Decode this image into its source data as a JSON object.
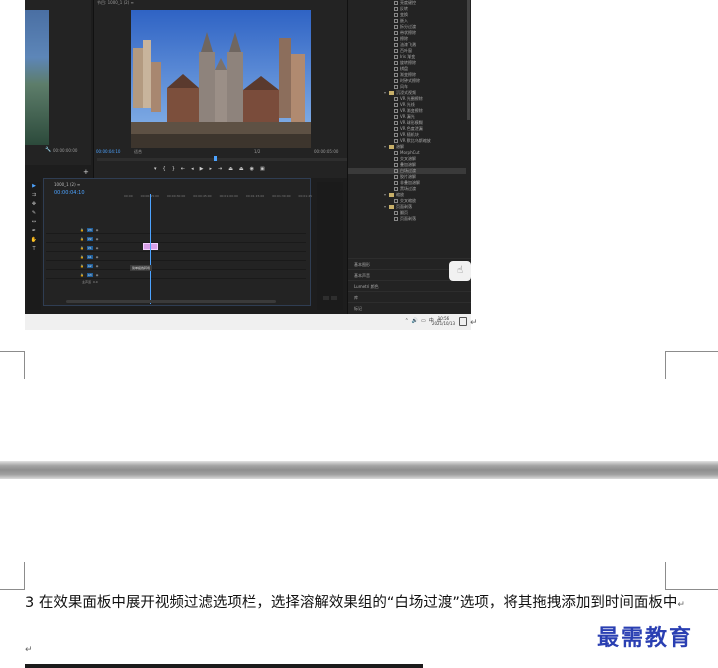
{
  "screenshot": {
    "source_monitor": {
      "timecode": "00:00:00:00"
    },
    "program_monitor": {
      "title": "节目: 1000_1 (2) ≡",
      "timecode_current": "00:00:04:10",
      "fit": "适合",
      "scale": "1/2",
      "timecode_total": "00:00:05:00"
    },
    "effects": {
      "items": [
        {
          "label": "亮度键控",
          "kind": "effect"
        },
        {
          "label": "反转",
          "kind": "effect"
        },
        {
          "label": "变换",
          "kind": "effect"
        },
        {
          "label": "嵌入",
          "kind": "effect"
        },
        {
          "label": "拆分过渡",
          "kind": "effect"
        },
        {
          "label": "带状擦除",
          "kind": "effect"
        },
        {
          "label": "擦除",
          "kind": "effect"
        },
        {
          "label": "油漆飞溅",
          "kind": "effect"
        },
        {
          "label": "百叶窗",
          "kind": "effect"
        },
        {
          "label": "Iris 渐变",
          "kind": "effect"
        },
        {
          "label": "旋转擦除",
          "kind": "effect"
        },
        {
          "label": "棋盘",
          "kind": "effect"
        },
        {
          "label": "渐变擦除",
          "kind": "effect"
        },
        {
          "label": "时钟式擦除",
          "kind": "effect"
        },
        {
          "label": "风车",
          "kind": "effect"
        },
        {
          "label": "沉浸式视频",
          "kind": "folder"
        },
        {
          "label": "VR 光圈擦除",
          "kind": "effect"
        },
        {
          "label": "VR 光线",
          "kind": "effect"
        },
        {
          "label": "VR 渐变擦除",
          "kind": "effect"
        },
        {
          "label": "VR 漏光",
          "kind": "effect"
        },
        {
          "label": "VR 球形模糊",
          "kind": "effect"
        },
        {
          "label": "VR 色度泄漏",
          "kind": "effect"
        },
        {
          "label": "VR 随机块",
          "kind": "effect"
        },
        {
          "label": "VR 默比乌斯缩放",
          "kind": "effect"
        },
        {
          "label": "溶解",
          "kind": "folder"
        },
        {
          "label": "MorphCut",
          "kind": "effect"
        },
        {
          "label": "交叉溶解",
          "kind": "effect"
        },
        {
          "label": "叠加溶解",
          "kind": "effect"
        },
        {
          "label": "白场过渡",
          "kind": "effect",
          "selected": true
        },
        {
          "label": "胶片溶解",
          "kind": "effect"
        },
        {
          "label": "非叠加溶解",
          "kind": "effect"
        },
        {
          "label": "黑场过渡",
          "kind": "effect"
        },
        {
          "label": "缩放",
          "kind": "folder"
        },
        {
          "label": "交叉缩放",
          "kind": "effect"
        },
        {
          "label": "页面剥落",
          "kind": "folder"
        },
        {
          "label": "翻页",
          "kind": "effect"
        },
        {
          "label": "页面剥落",
          "kind": "effect"
        }
      ],
      "footer": [
        "基本图形",
        "基本声音",
        "Lumetri 颜色",
        "库",
        "标记"
      ]
    },
    "timeline": {
      "tab": "1000_1 (2) ≡",
      "timecode": "00:00:04:10",
      "ruler": [
        "00:00",
        "00:00:15:00",
        "00:00:30:00",
        "00:00:45:00",
        "00:01:00:00",
        "00:01:15:00",
        "00:01:30:00",
        "00:01:45"
      ],
      "tracks": [
        "V3",
        "V2",
        "V1",
        "A1",
        "A2",
        "A3"
      ],
      "master": "主声道",
      "master_value": "0.0",
      "tooltip": "简单拖拽转场"
    },
    "tray": {
      "time": "10:56",
      "date": "2021/10/13"
    }
  },
  "document": {
    "step_text": "3 在效果面板中展开视频过滤选项栏，选择溶解效果组的“白场过渡”选项，将其拖拽添加到时间面板中",
    "return_mark": "↵",
    "watermark": "最需教育"
  }
}
